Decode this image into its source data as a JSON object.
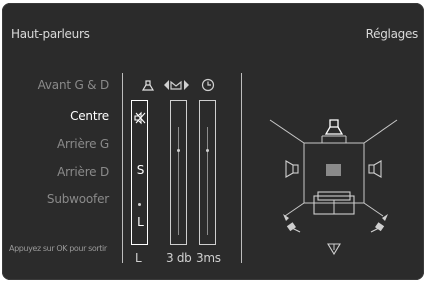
{
  "header": {
    "title_left": "Haut-parleurs",
    "title_right": "Réglages"
  },
  "menu": {
    "items": [
      {
        "label": "Avant G & D",
        "active": false
      },
      {
        "label": "Centre",
        "active": true
      },
      {
        "label": "Arrière G",
        "active": false
      },
      {
        "label": "Arrière D",
        "active": false
      },
      {
        "label": "Subwoofer",
        "active": false
      }
    ]
  },
  "hint": "Appuyez sur OK pour sortir",
  "columns": {
    "level_letters": [
      "S",
      "L"
    ],
    "level_bottom": "L",
    "delay_bottom": "3 db",
    "time_bottom": "3ms"
  },
  "icons": {
    "header": [
      "speaker-icon",
      "balance-icon",
      "clock-icon"
    ],
    "mute": "mute-icon",
    "diagram": [
      "front-speaker-icon",
      "left-speaker-icon",
      "right-speaker-icon",
      "center-speaker-icon",
      "sofa-icon",
      "rear-left-speaker-icon",
      "rear-right-speaker-icon",
      "subwoofer-icon"
    ]
  },
  "colors": {
    "background": "#2b2b2b",
    "text": "#d9d9d9",
    "active": "#ffffff",
    "inactive": "#8a8a8a"
  }
}
